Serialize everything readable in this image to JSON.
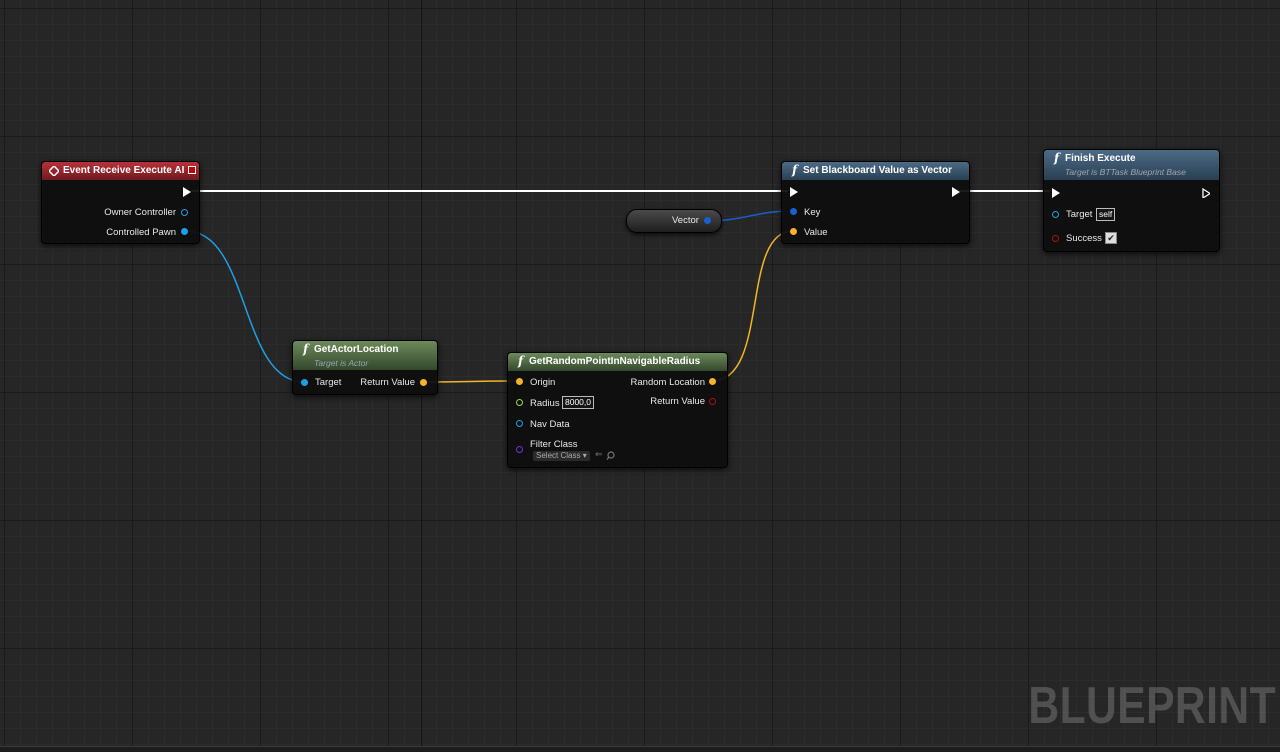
{
  "nodes": {
    "event_receive": {
      "title": "Event Receive Execute AI",
      "pins": {
        "owner_controller": "Owner Controller",
        "controlled_pawn": "Controlled Pawn"
      }
    },
    "set_blackboard": {
      "title": "Set Blackboard Value as Vector",
      "pins": {
        "key": "Key",
        "value": "Value"
      }
    },
    "finish_execute": {
      "title": "Finish Execute",
      "subtitle": "Target is BTTask Blueprint Base",
      "pins": {
        "target": "Target",
        "target_value": "self",
        "success": "Success",
        "success_checked": "✔"
      }
    },
    "get_actor_location": {
      "title": "GetActorLocation",
      "subtitle": "Target is Actor",
      "pins": {
        "target": "Target",
        "return_value": "Return Value"
      }
    },
    "get_random_point": {
      "title": "GetRandomPointInNavigableRadius",
      "pins": {
        "origin": "Origin",
        "radius": "Radius",
        "radius_value": "8000,0",
        "nav_data": "Nav Data",
        "filter_class": "Filter Class",
        "filter_class_select": "Select Class",
        "random_location": "Random Location",
        "return_value": "Return Value"
      }
    },
    "vector_variable": {
      "label": "Vector"
    }
  },
  "watermark": "BLUEPRINT",
  "colors": {
    "exec_wire": "#ffffff",
    "object_pin": "#1ea0e6",
    "vector_pin": "#f5b428",
    "float_pin": "#8fe04d",
    "blackboard_key_pin": "#1a5fd0",
    "class_pin": "#7a2ed8",
    "bool_pin": "#b01010",
    "event_header": "#b8313a",
    "function_header": "#4b6b86",
    "pure_function_header": "#6c8a5b"
  },
  "icons": [
    "event-diamond-icon",
    "function-f-icon",
    "exec-pin-icon",
    "dropdown-arrow-icon",
    "use-selected-arrow-icon",
    "browse-magnifier-icon",
    "checkbox-check-icon"
  ]
}
